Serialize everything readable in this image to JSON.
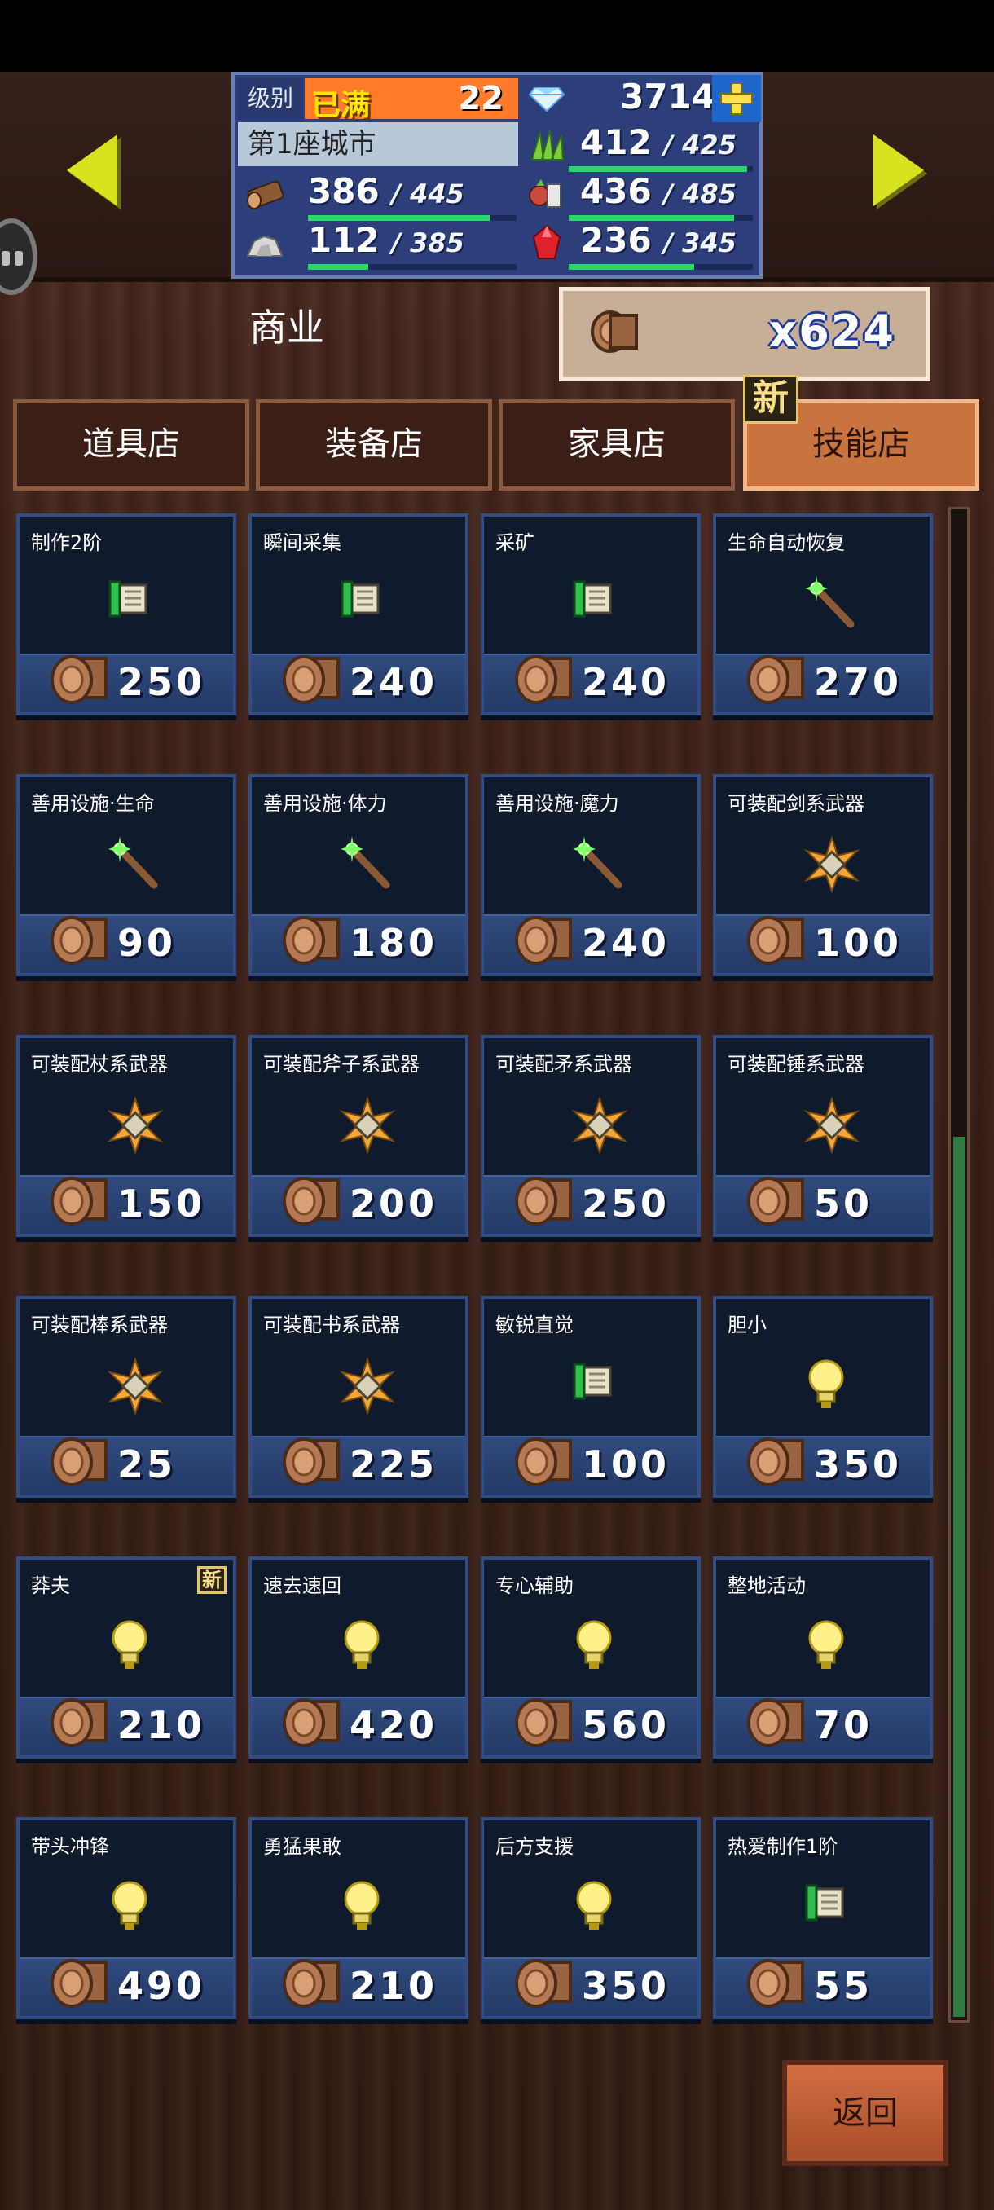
{
  "header": {
    "level_label": "级别",
    "level_full": "已满",
    "level_value": "22",
    "gems": "3714",
    "city": "第1座城市",
    "resources": [
      {
        "icon": "grass-icon",
        "value": "412",
        "max": "425",
        "ratio": 0.97
      },
      {
        "icon": "wood-log-icon",
        "value": "386",
        "max": "445",
        "ratio": 0.87
      },
      {
        "icon": "meat-veg-icon",
        "value": "436",
        "max": "485",
        "ratio": 0.9
      },
      {
        "icon": "stone-icon",
        "value": "112",
        "max": "385",
        "ratio": 0.29
      },
      {
        "icon": "red-crystal-icon",
        "value": "236",
        "max": "345",
        "ratio": 0.68
      }
    ]
  },
  "shop": {
    "title": "商业",
    "currency_count": "x624",
    "tabs": [
      "道具店",
      "装备店",
      "家具店",
      "技能店"
    ],
    "active_tab": 3,
    "new_badge": "新",
    "back_label": "返回"
  },
  "items": [
    {
      "name": "制作2阶",
      "price": "250",
      "icon": "scroll-icon"
    },
    {
      "name": "瞬间采集",
      "price": "240",
      "icon": "scroll-icon"
    },
    {
      "name": "采矿",
      "price": "240",
      "icon": "scroll-icon"
    },
    {
      "name": "生命自动恢复",
      "price": "270",
      "icon": "wand-icon"
    },
    {
      "name": "善用设施·生命",
      "price": "90",
      "icon": "wand-icon"
    },
    {
      "name": "善用设施·体力",
      "price": "180",
      "icon": "wand-icon"
    },
    {
      "name": "善用设施·魔力",
      "price": "240",
      "icon": "wand-icon"
    },
    {
      "name": "可装配剑系武器",
      "price": "100",
      "icon": "weapon-burst-icon"
    },
    {
      "name": "可装配杖系武器",
      "price": "150",
      "icon": "weapon-burst-icon"
    },
    {
      "name": "可装配斧子系武器",
      "price": "200",
      "icon": "weapon-burst-icon"
    },
    {
      "name": "可装配矛系武器",
      "price": "250",
      "icon": "weapon-burst-icon"
    },
    {
      "name": "可装配锤系武器",
      "price": "50",
      "icon": "weapon-burst-icon"
    },
    {
      "name": "可装配棒系武器",
      "price": "25",
      "icon": "weapon-burst-icon"
    },
    {
      "name": "可装配书系武器",
      "price": "225",
      "icon": "weapon-burst-icon"
    },
    {
      "name": "敏锐直觉",
      "price": "100",
      "icon": "scroll-icon"
    },
    {
      "name": "胆小",
      "price": "350",
      "icon": "lightbulb-icon"
    },
    {
      "name": "莽夫",
      "price": "210",
      "icon": "lightbulb-icon",
      "new": true
    },
    {
      "name": "速去速回",
      "price": "420",
      "icon": "lightbulb-icon"
    },
    {
      "name": "专心辅助",
      "price": "560",
      "icon": "lightbulb-icon"
    },
    {
      "name": "整地活动",
      "price": "70",
      "icon": "lightbulb-icon"
    },
    {
      "name": "带头冲锋",
      "price": "490",
      "icon": "lightbulb-icon"
    },
    {
      "name": "勇猛果敢",
      "price": "210",
      "icon": "lightbulb-icon"
    },
    {
      "name": "后方支援",
      "price": "350",
      "icon": "lightbulb-icon"
    },
    {
      "name": "热爱制作1阶",
      "price": "55",
      "icon": "scroll-icon"
    }
  ]
}
